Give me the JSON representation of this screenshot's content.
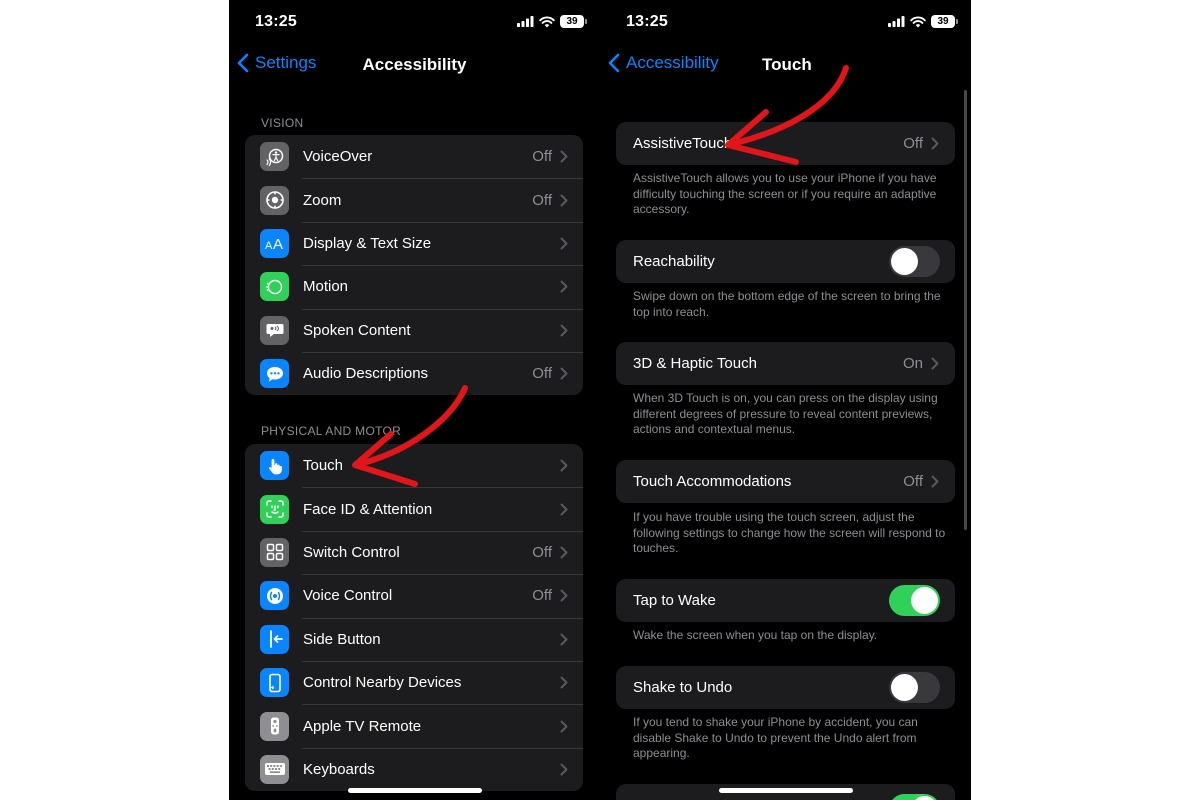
{
  "left_screen": {
    "status": {
      "time": "13:25",
      "battery": "39"
    },
    "nav": {
      "back_label": "Settings",
      "title": "Accessibility"
    },
    "vision": {
      "header": "VISION",
      "items": [
        {
          "label": "VoiceOver",
          "value": "Off",
          "icon": "voiceover-icon",
          "color": "#636366"
        },
        {
          "label": "Zoom",
          "value": "Off",
          "icon": "zoom-icon",
          "color": "#636366"
        },
        {
          "label": "Display & Text Size",
          "value": "",
          "icon": "text-size-icon",
          "color": "#0a84ff"
        },
        {
          "label": "Motion",
          "value": "",
          "icon": "motion-icon",
          "color": "#30d158"
        },
        {
          "label": "Spoken Content",
          "value": "",
          "icon": "spoken-content-icon",
          "color": "#636366"
        },
        {
          "label": "Audio Descriptions",
          "value": "Off",
          "icon": "audio-descriptions-icon",
          "color": "#0a84ff"
        }
      ]
    },
    "physical": {
      "header": "PHYSICAL AND MOTOR",
      "items": [
        {
          "label": "Touch",
          "value": "",
          "icon": "hand-touch-icon",
          "color": "#0a84ff"
        },
        {
          "label": "Face ID & Attention",
          "value": "",
          "icon": "face-id-icon",
          "color": "#30d158"
        },
        {
          "label": "Switch Control",
          "value": "Off",
          "icon": "switch-control-icon",
          "color": "#636366"
        },
        {
          "label": "Voice Control",
          "value": "Off",
          "icon": "voice-control-icon",
          "color": "#0a84ff"
        },
        {
          "label": "Side Button",
          "value": "",
          "icon": "side-button-icon",
          "color": "#0a84ff"
        },
        {
          "label": "Control Nearby Devices",
          "value": "",
          "icon": "nearby-devices-icon",
          "color": "#0a84ff"
        },
        {
          "label": "Apple TV Remote",
          "value": "",
          "icon": "tv-remote-icon",
          "color": "#8e8e93"
        },
        {
          "label": "Keyboards",
          "value": "",
          "icon": "keyboard-icon",
          "color": "#8e8e93"
        }
      ]
    }
  },
  "right_screen": {
    "status": {
      "time": "13:25",
      "battery": "39"
    },
    "nav": {
      "back_label": "Accessibility",
      "title": "Touch"
    },
    "assistive": {
      "label": "AssistiveTouch",
      "value": "Off",
      "footer": "AssistiveTouch allows you to use your iPhone if you have difficulty touching the screen or if you require an adaptive accessory."
    },
    "reachability": {
      "label": "Reachability",
      "state": "off",
      "footer": "Swipe down on the bottom edge of the screen to bring the top into reach."
    },
    "haptic": {
      "label": "3D & Haptic Touch",
      "value": "On",
      "footer": "When 3D Touch is on, you can press on the display using different degrees of pressure to reveal content previews, actions and contextual menus."
    },
    "accommodations": {
      "label": "Touch Accommodations",
      "value": "Off",
      "footer": "If you have trouble using the touch screen, adjust the following settings to change how the screen will respond to touches."
    },
    "tap_to_wake": {
      "label": "Tap to Wake",
      "state": "on",
      "footer": "Wake the screen when you tap on the display."
    },
    "shake_to_undo": {
      "label": "Shake to Undo",
      "state": "off",
      "footer": "If you tend to shake your iPhone by accident, you can disable Shake to Undo to prevent the Undo alert from appearing."
    }
  },
  "colors": {
    "accent": "#0a84ff",
    "toggle_on": "#30d158",
    "annotation_arrow": "#e0161b"
  }
}
